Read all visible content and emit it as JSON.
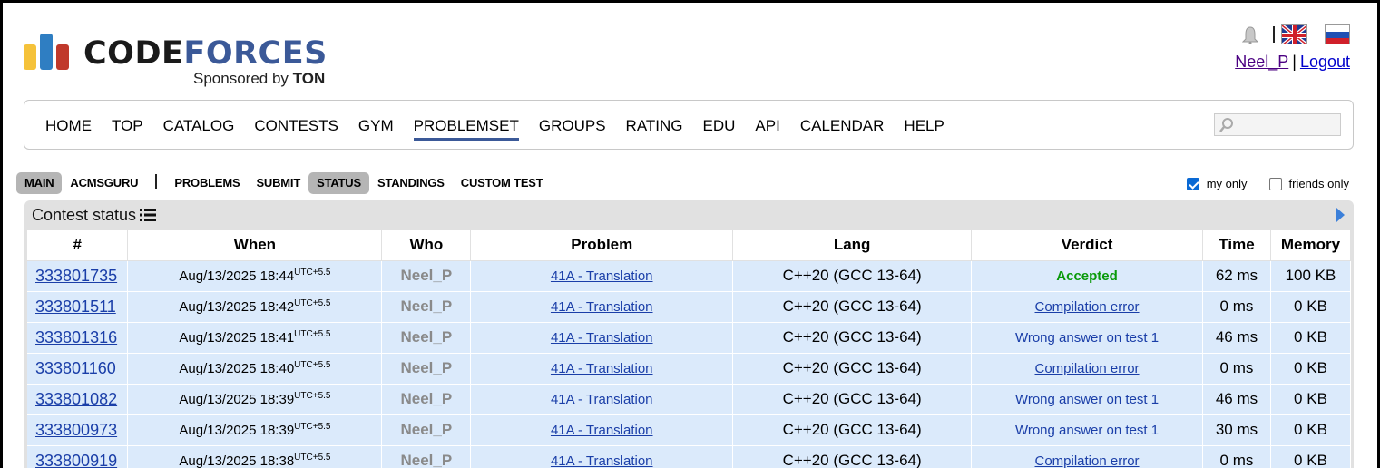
{
  "header": {
    "logo_word1": "CODE",
    "logo_word2": "FORCES",
    "sponsor_prefix": "Sponsored by",
    "sponsor_name": "TON",
    "user": "Neel_P",
    "logout": "Logout",
    "separator": "|"
  },
  "main_menu": {
    "items": [
      "HOME",
      "TOP",
      "CATALOG",
      "CONTESTS",
      "GYM",
      "PROBLEMSET",
      "GROUPS",
      "RATING",
      "EDU",
      "API",
      "CALENDAR",
      "HELP"
    ],
    "active": "PROBLEMSET"
  },
  "sub_menu": {
    "items": [
      "MAIN",
      "ACMSGURU",
      "PROBLEMS",
      "SUBMIT",
      "STATUS",
      "STANDINGS",
      "CUSTOM TEST"
    ],
    "active": [
      "MAIN",
      "STATUS"
    ]
  },
  "filters": {
    "my_only": {
      "label": "my only",
      "checked": true
    },
    "friends_only": {
      "label": "friends only",
      "checked": false
    }
  },
  "status": {
    "title": "Contest status",
    "columns": [
      "#",
      "When",
      "Who",
      "Problem",
      "Lang",
      "Verdict",
      "Time",
      "Memory"
    ],
    "rows": [
      {
        "id": "333801735",
        "when": "Aug/13/2025 18:44",
        "tz": "UTC+5.5",
        "who": "Neel_P",
        "problem": "41A - Translation",
        "lang": "C++20 (GCC 13-64)",
        "verdict": "Accepted",
        "verdict_type": "ok",
        "time": "62 ms",
        "memory": "100 KB"
      },
      {
        "id": "333801511",
        "when": "Aug/13/2025 18:42",
        "tz": "UTC+5.5",
        "who": "Neel_P",
        "problem": "41A - Translation",
        "lang": "C++20 (GCC 13-64)",
        "verdict": "Compilation error",
        "verdict_type": "ce",
        "time": "0 ms",
        "memory": "0 KB"
      },
      {
        "id": "333801316",
        "when": "Aug/13/2025 18:41",
        "tz": "UTC+5.5",
        "who": "Neel_P",
        "problem": "41A - Translation",
        "lang": "C++20 (GCC 13-64)",
        "verdict": "Wrong answer on test 1",
        "verdict_type": "wa",
        "time": "46 ms",
        "memory": "0 KB"
      },
      {
        "id": "333801160",
        "when": "Aug/13/2025 18:40",
        "tz": "UTC+5.5",
        "who": "Neel_P",
        "problem": "41A - Translation",
        "lang": "C++20 (GCC 13-64)",
        "verdict": "Compilation error",
        "verdict_type": "ce",
        "time": "0 ms",
        "memory": "0 KB"
      },
      {
        "id": "333801082",
        "when": "Aug/13/2025 18:39",
        "tz": "UTC+5.5",
        "who": "Neel_P",
        "problem": "41A - Translation",
        "lang": "C++20 (GCC 13-64)",
        "verdict": "Wrong answer on test 1",
        "verdict_type": "wa",
        "time": "46 ms",
        "memory": "0 KB"
      },
      {
        "id": "333800973",
        "when": "Aug/13/2025 18:39",
        "tz": "UTC+5.5",
        "who": "Neel_P",
        "problem": "41A - Translation",
        "lang": "C++20 (GCC 13-64)",
        "verdict": "Wrong answer on test 1",
        "verdict_type": "wa",
        "time": "30 ms",
        "memory": "0 KB"
      },
      {
        "id": "333800919",
        "when": "Aug/13/2025 18:38",
        "tz": "UTC+5.5",
        "who": "Neel_P",
        "problem": "41A - Translation",
        "lang": "C++20 (GCC 13-64)",
        "verdict": "Compilation error",
        "verdict_type": "ce",
        "time": "0 ms",
        "memory": "0 KB"
      }
    ]
  },
  "colors": {
    "brand_blue": "#3b5998",
    "logo_yellow": "#f5c23a",
    "logo_blue": "#2f7ec2",
    "logo_red": "#c0392b",
    "row_bg": "#dbeafb",
    "accepted": "#0a9a0a",
    "link": "#1a3ea8"
  }
}
